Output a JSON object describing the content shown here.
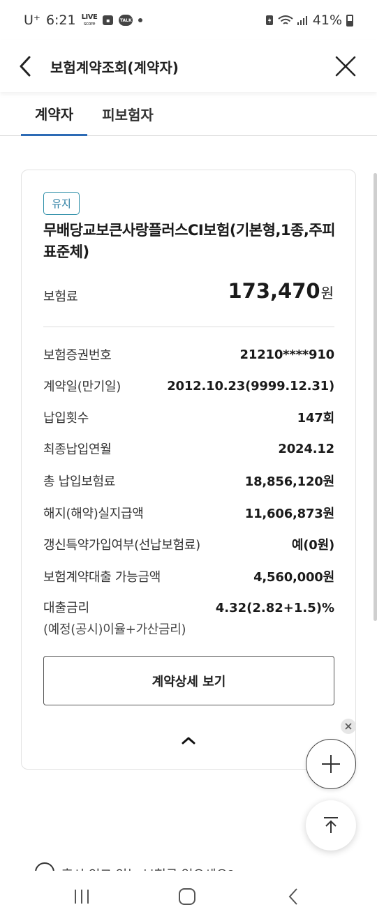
{
  "status_bar": {
    "carrier": "U⁺",
    "time": "6:21",
    "live_label": "LIVE",
    "live_sub": "score",
    "talk_label": "TALK",
    "battery": "41%"
  },
  "header": {
    "title": "보험계약조회(계약자)"
  },
  "tabs": [
    {
      "label": "계약자",
      "active": true
    },
    {
      "label": "피보험자",
      "active": false
    }
  ],
  "contract": {
    "status": "유지",
    "product_name": "무배당교보큰사랑플러스CI보험(기본형,1종,주피표준체)",
    "premium_label": "보험료",
    "premium_amount": "173,470",
    "premium_unit": "원",
    "details": [
      {
        "label": "보험증권번호",
        "value": "21210****910"
      },
      {
        "label": "계약일(만기일)",
        "value": "2012.10.23(9999.12.31)"
      },
      {
        "label": "납입횟수",
        "value": "147회"
      },
      {
        "label": "최종납입연월",
        "value": "2024.12"
      },
      {
        "label": "총 납입보험료",
        "value": "18,856,120원"
      },
      {
        "label": "해지(해약)실지급액",
        "value": "11,606,873원"
      },
      {
        "label": "갱신특약가입여부(선납보험료)",
        "value": "예(0원)"
      },
      {
        "label": "보험계약대출 가능금액",
        "value": "4,560,000원"
      }
    ],
    "rate": {
      "label": "대출금리",
      "sub_label": "(예정(공시)이율+가산금리)",
      "value": "4.32(2.82+1.5)%"
    },
    "detail_button": "계약상세 보기"
  },
  "notice_peek": "혹시 잊고 있는 보험금 없으세요?",
  "colors": {
    "accent": "#2d6bb5",
    "badge": "#2d8ea8"
  },
  "icons": [
    "back-arrow-icon",
    "close-icon",
    "chevron-up-icon",
    "plus-icon",
    "arrow-to-top-icon",
    "info-icon",
    "recent-apps-icon",
    "home-icon",
    "nav-back-icon"
  ]
}
